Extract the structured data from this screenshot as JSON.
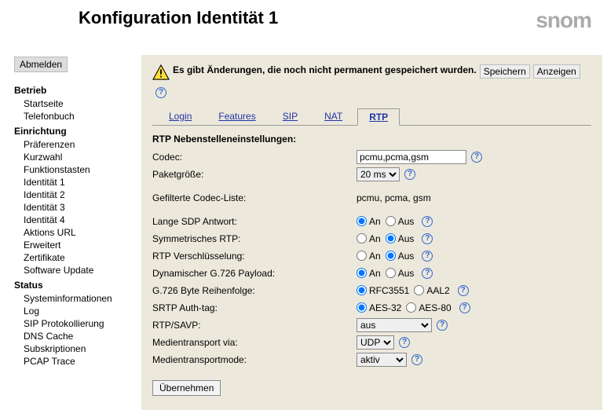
{
  "header": {
    "title": "Konfiguration Identität 1",
    "logo": "snom"
  },
  "sidebar": {
    "logout": "Abmelden",
    "cats": [
      {
        "label": "Betrieb",
        "items": [
          "Startseite",
          "Telefonbuch"
        ]
      },
      {
        "label": "Einrichtung",
        "items": [
          "Präferenzen",
          "Kurzwahl",
          "Funktionstasten",
          "Identität 1",
          "Identität 2",
          "Identität 3",
          "Identität 4",
          "Aktions URL",
          "Erweitert",
          "Zertifikate",
          "Software Update"
        ]
      },
      {
        "label": "Status",
        "items": [
          "Systeminformationen",
          "Log",
          "SIP Protokollierung",
          "DNS Cache",
          "Subskriptionen",
          "PCAP Trace"
        ]
      }
    ]
  },
  "warn": {
    "msg": "Es gibt Änderungen, die noch nicht permanent gespeichert wurden.",
    "save": "Speichern",
    "show": "Anzeigen"
  },
  "tabs": [
    "Login",
    "Features",
    "SIP",
    "NAT",
    "RTP"
  ],
  "active_tab": 4,
  "section": "RTP Nebenstelleneinstellungen:",
  "rows": {
    "codec_lbl": "Codec:",
    "codec_val": "pcmu,pcma,gsm",
    "pkt_lbl": "Paketgröße:",
    "pkt_opts": [
      "20 ms"
    ],
    "flt_lbl": "Gefilterte Codec-Liste:",
    "flt_val": "pcmu, pcma, gsm",
    "sdp_lbl": "Lange SDP Antwort:",
    "sym_lbl": "Symmetrisches RTP:",
    "enc_lbl": "RTP Verschlüsselung:",
    "dyn_lbl": "Dynamischer G.726 Payload:",
    "byte_lbl": "G.726 Byte Reihenfolge:",
    "srtp_lbl": "SRTP Auth-tag:",
    "savp_lbl": "RTP/SAVP:",
    "savp_opts": [
      "aus"
    ],
    "via_lbl": "Medientransport via:",
    "via_opts": [
      "UDP"
    ],
    "mode_lbl": "Medientransportmode:",
    "mode_opts": [
      "aktiv"
    ]
  },
  "radio": {
    "on": "An",
    "off": "Aus",
    "rfc": "RFC3551",
    "aal": "AAL2",
    "aes32": "AES-32",
    "aes80": "AES-80"
  },
  "states": {
    "sdp": "on",
    "sym": "off",
    "enc": "off",
    "dyn": "on",
    "byte": "rfc",
    "srtp": "aes32"
  },
  "apply": "Übernehmen"
}
